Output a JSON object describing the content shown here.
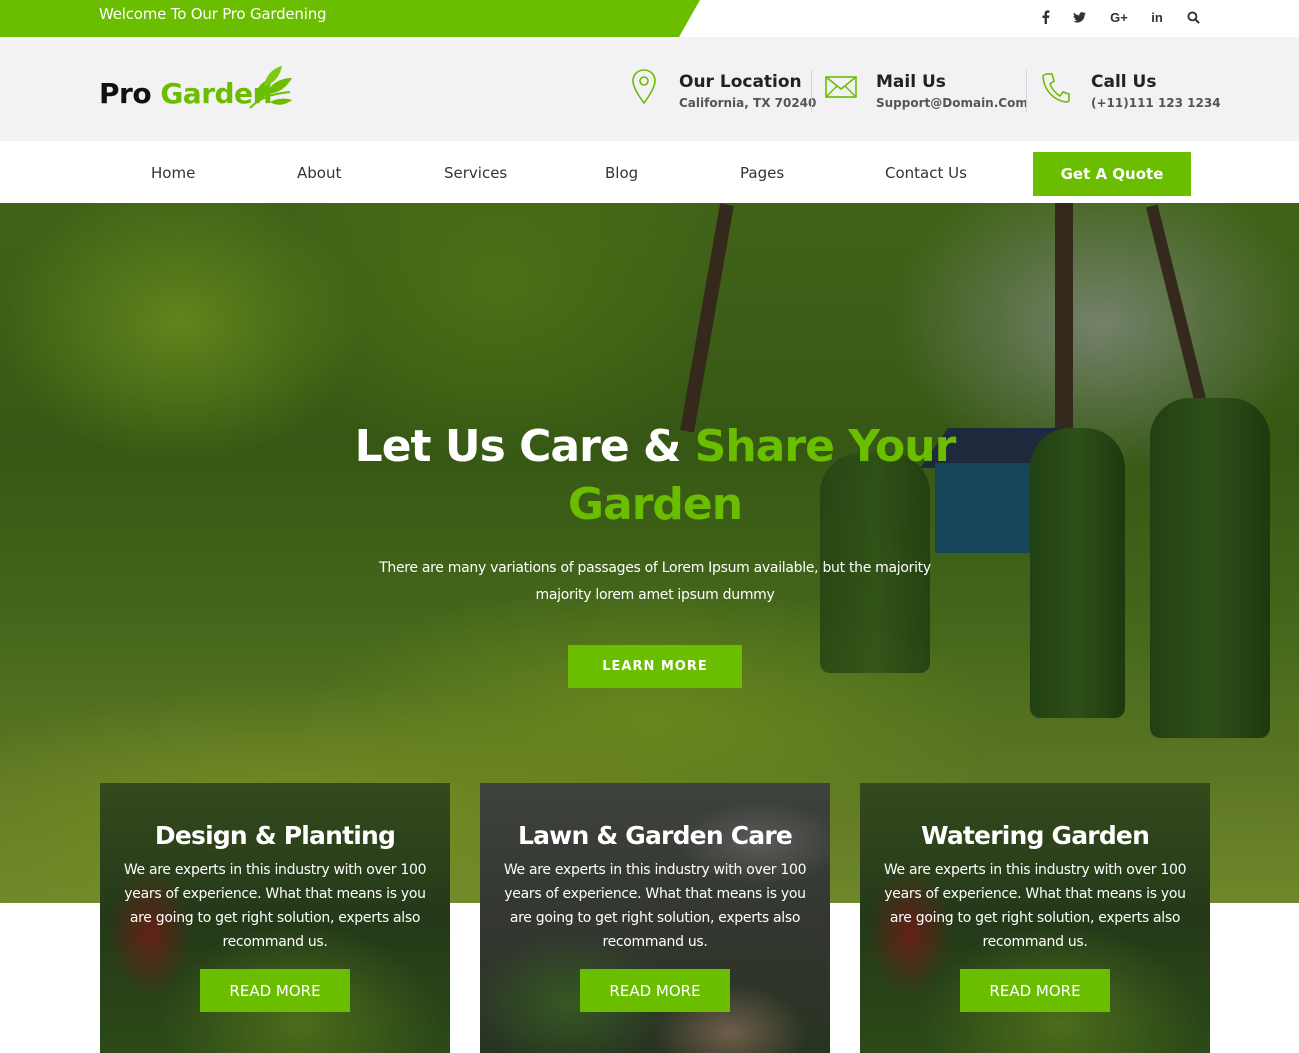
{
  "topbar": {
    "welcome": "Welcome To Our Pro Gardening",
    "social": [
      {
        "icon": "facebook-icon",
        "glyph": "f"
      },
      {
        "icon": "twitter-icon",
        "glyph": "🐦"
      },
      {
        "icon": "google-plus-icon",
        "glyph": "G+"
      },
      {
        "icon": "linkedin-icon",
        "glyph": "in"
      },
      {
        "icon": "search-icon",
        "glyph": "⌕"
      }
    ]
  },
  "header": {
    "logo": {
      "pro": "Pro",
      "garden": "Garden"
    },
    "location": {
      "title": "Our Location",
      "value": "California, TX 70240",
      "icon": "map-pin-icon"
    },
    "mail": {
      "title": "Mail Us",
      "value": "Support@Domain.Com",
      "icon": "envelope-icon"
    },
    "call": {
      "title": "Call Us",
      "value": "(+11)111 123 1234",
      "icon": "phone-icon"
    }
  },
  "nav": {
    "items": [
      "Home",
      "About",
      "Services",
      "Blog",
      "Pages",
      "Contact Us"
    ],
    "cta": "Get A Quote"
  },
  "hero": {
    "title_white": "Let Us Care & ",
    "title_green": "Share Your Garden",
    "description": "There are many variations of passages of Lorem Ipsum available, but the majority majority lorem amet ipsum dummy",
    "button": "LEARN MORE"
  },
  "services": [
    {
      "title": "Design & Planting",
      "text": "We are experts in this industry with over 100 years of experience. What that means is you are going to get right solution, experts also recommand us.",
      "button": "READ MORE"
    },
    {
      "title": "Lawn & Garden Care",
      "text": "We are experts in this industry with over 100 years of experience. What that means is you are going to get right solution, experts also recommand us.",
      "button": "READ MORE"
    },
    {
      "title": "Watering Garden",
      "text": "We are experts in this industry with over 100 years of experience. What that means is you are going to get right solution, experts also recommand us.",
      "button": "READ MORE"
    }
  ],
  "colors": {
    "brand_green": "#6bbd00",
    "header_bg": "#f2f2f4"
  }
}
